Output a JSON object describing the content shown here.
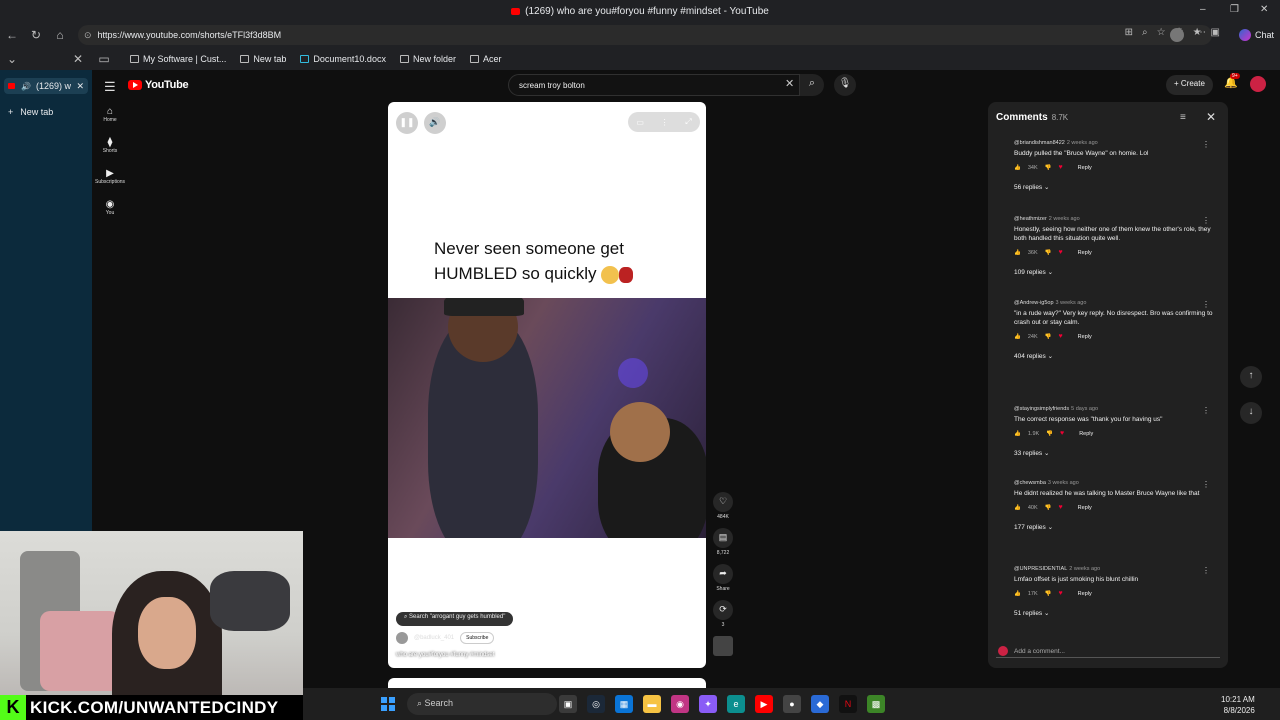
{
  "browser": {
    "window_title": "(1269) who are you#foryou #funny #mindset - YouTube",
    "url": "https://www.youtube.com/shorts/eTFl3f3d8BM",
    "chat_label": "Chat",
    "bookmarks": [
      "My Software | Cust...",
      "New tab",
      "Document10.docx",
      "New folder",
      "Acer"
    ],
    "tabs": [
      {
        "label": "(1269) w"
      },
      {
        "label": "New tab"
      }
    ]
  },
  "youtube": {
    "logo": "YouTube",
    "search_value": "scream troy bolton",
    "create_label": "Create",
    "notification_badge": "9+",
    "guide": [
      {
        "label": "Home",
        "icon": "home-icon"
      },
      {
        "label": "Shorts",
        "icon": "shorts-icon"
      },
      {
        "label": "Subscriptions",
        "icon": "subscriptions-icon"
      },
      {
        "label": "You",
        "icon": "you-icon"
      }
    ]
  },
  "short": {
    "caption": "Never seen someone get HUMBLED so quickly",
    "search_chip": "Search \"arrogant guy gets humbled\"",
    "channel": "@badluck_401",
    "subscribe_label": "Subscribe",
    "title": "who are you#foryou #funny #mindset",
    "actions": {
      "likes": "484K",
      "comments": "8,722",
      "share": "Share",
      "remix": "3"
    }
  },
  "comments": {
    "title": "Comments",
    "count": "8.7K",
    "add_placeholder": "Add a comment...",
    "items": [
      {
        "user": "@briandishman8422",
        "ago": "2 weeks ago",
        "text": "Buddy pulled the \"Bruce Wayne\" on homie. Lol",
        "likes": "34K",
        "replies": "56 replies"
      },
      {
        "user": "@heathmizer",
        "ago": "2 weeks ago",
        "text": "Honestly, seeing how neither one of them knew the other's role, they both handled this situation quite well.",
        "likes": "36K",
        "replies": "109 replies"
      },
      {
        "user": "@Andrew-ig5op",
        "ago": "3 weeks ago",
        "text": "\"in a rude way?\"  Very key reply. No disrespect. Bro was confirming to crash out or stay calm.",
        "likes": "24K",
        "replies": "404 replies"
      },
      {
        "user": "@stayingsimplyfriends",
        "ago": "5 days ago",
        "text": "The correct response was \"thank you for having us\"",
        "likes": "1.9K",
        "replies": "33 replies"
      },
      {
        "user": "@chewsmba",
        "ago": "3 weeks ago",
        "text": "He didnt realized he was talking to Master Bruce Wayne like that",
        "likes": "40K",
        "replies": "177 replies"
      },
      {
        "user": "@UNPRESIDENTIAL",
        "ago": "2 weeks ago",
        "text": "Lmfao offset is just smoking his blunt chillin",
        "likes": "17K",
        "replies": "51 replies"
      }
    ],
    "reply_label": "Reply"
  },
  "overlay": {
    "kick_letter": "K",
    "kick_text": "KICK.COM/UNWANTEDCINDY"
  },
  "taskbar": {
    "search_label": "Search",
    "time": "10:21 AM",
    "date": "8/8/2026"
  }
}
